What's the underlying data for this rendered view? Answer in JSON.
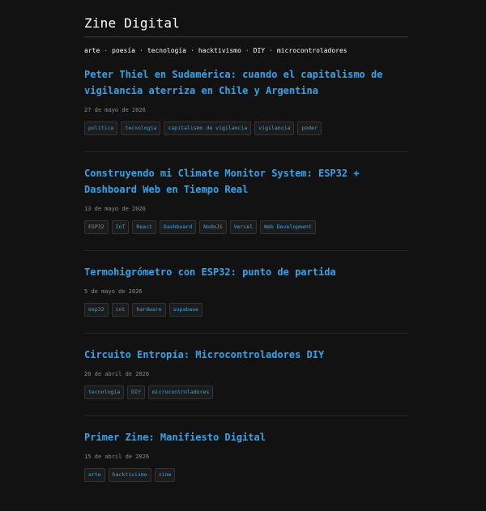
{
  "site": {
    "title": "Zine Digital"
  },
  "nav": {
    "items": [
      "arte",
      "poesía",
      "tecnología",
      "hacktivismo",
      "DIY",
      "microcontroladores"
    ],
    "separator": "·"
  },
  "posts": [
    {
      "title": "Peter Thiel en Sudamérica: cuando el capitalismo de vigilancia aterriza en Chile y Argentina",
      "date": "27 de mayo de 2026",
      "tags": [
        "política",
        "tecnología",
        "capitalismo de vigilancia",
        "vigilancia",
        "poder"
      ]
    },
    {
      "title": "Construyendo mi Climate Monitor System: ESP32 + Dashboard Web en Tiempo Real",
      "date": "13 de mayo de 2026",
      "tags": [
        "ESP32",
        "IoT",
        "React",
        "Dashboard",
        "NodeJS",
        "Vercel",
        "Web Development"
      ]
    },
    {
      "title": "Termohigrómetro con ESP32: punto de partida",
      "date": "5 de mayo de 2026",
      "tags": [
        "esp32",
        "iot",
        "hardware",
        "supabase"
      ]
    },
    {
      "title": "Circuito Entropía: Microcontroladores DIY",
      "date": "20 de abril de 2026",
      "tags": [
        "tecnología",
        "DIY",
        "microcontroladores"
      ]
    },
    {
      "title": "Primer Zine: Manifiesto Digital",
      "date": "15 de abril de 2026",
      "tags": [
        "arte",
        "hacktivismo",
        "zine"
      ]
    }
  ],
  "colors": {
    "background": "#121212",
    "accent": "#2aa6f0",
    "text": "#e6e6e6",
    "muted": "#8a8a8a"
  }
}
